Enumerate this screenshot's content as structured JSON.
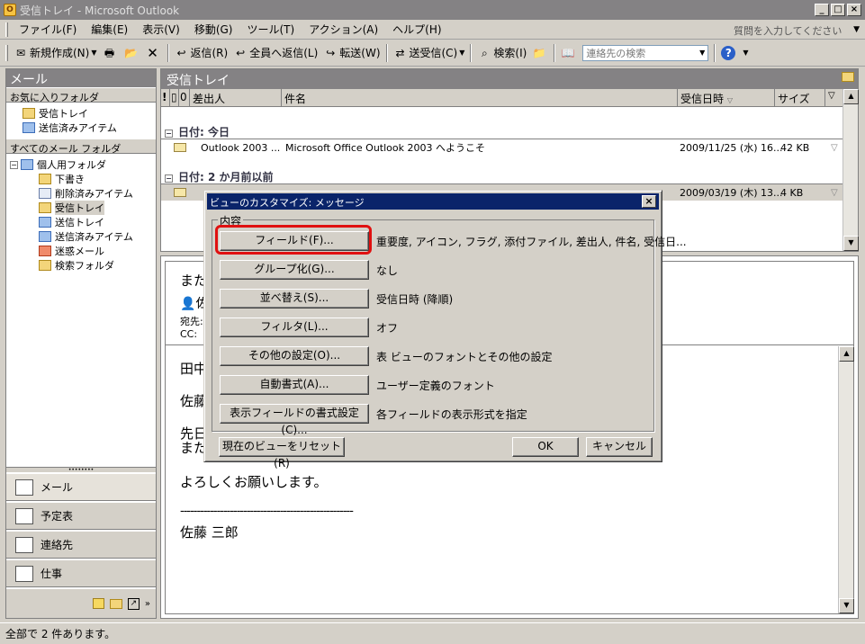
{
  "window": {
    "title": "受信トレイ - Microsoft Outlook",
    "app_icon": "outlook-icon"
  },
  "menubar": {
    "items": [
      "ファイル(F)",
      "編集(E)",
      "表示(V)",
      "移動(G)",
      "ツール(T)",
      "アクション(A)",
      "ヘルプ(H)"
    ],
    "help_placeholder": "質問を入力してください"
  },
  "toolbar": {
    "new": "新規作成(N)",
    "reply": "返信(R)",
    "reply_all": "全員へ返信(L)",
    "forward": "転送(W)",
    "send_receive": "送受信(C)",
    "find": "検索(I)",
    "contact_search_placeholder": "連絡先の検索"
  },
  "nav": {
    "header": "メール",
    "favorites_header": "お気に入りフォルダ",
    "favorites": [
      "受信トレイ",
      "送信済みアイテム"
    ],
    "all_header": "すべてのメール フォルダ",
    "root": "個人用フォルダ",
    "folders": [
      "下書き",
      "削除済みアイテム",
      "受信トレイ",
      "送信トレイ",
      "送信済みアイテム",
      "迷惑メール",
      "検索フォルダ"
    ],
    "buttons": [
      "メール",
      "予定表",
      "連絡先",
      "仕事"
    ]
  },
  "list": {
    "header": "受信トレイ",
    "columns": [
      "差出人",
      "件名",
      "受信日時",
      "サイズ"
    ],
    "groups": [
      {
        "label": "日付: 今日",
        "rows": [
          {
            "from": "Outlook 2003 ...",
            "subject": "Microsoft Office Outlook 2003 へようこそ",
            "received": "2009/11/25 (水) 16...",
            "size": "42 KB"
          }
        ]
      },
      {
        "label": "日付: 2 か月前以前",
        "rows": [
          {
            "from": "",
            "subject": "",
            "received": "2009/03/19 (木) 13...",
            "size": "4 KB"
          }
        ]
      }
    ]
  },
  "reading": {
    "subject_fragment": "また",
    "to_label": "宛先:",
    "cc_label": "CC:",
    "sender_fragment": "佐",
    "body_lines": [
      "田中",
      "佐藤",
      "先日",
      "また"
    ],
    "closing": "よろしくお願いします。",
    "separator": "----------------------------------------------------",
    "signature": "佐藤 三郎"
  },
  "dialog": {
    "title": "ビューのカスタマイズ: メッセージ",
    "group_label": "内容",
    "rows": [
      {
        "button": "フィールド(F)...",
        "value": "重要度, アイコン, フラグ, 添付ファイル, 差出人, 件名, 受信日..."
      },
      {
        "button": "グループ化(G)...",
        "value": "なし"
      },
      {
        "button": "並べ替え(S)...",
        "value": "受信日時 (降順)"
      },
      {
        "button": "フィルタ(L)...",
        "value": "オフ"
      },
      {
        "button": "その他の設定(O)...",
        "value": "表 ビューのフォントとその他の設定"
      },
      {
        "button": "自動書式(A)...",
        "value": "ユーザー定義のフォント"
      },
      {
        "button": "表示フィールドの書式設定(C)...",
        "value": "各フィールドの表示形式を指定"
      }
    ],
    "reset": "現在のビューをリセット(R)",
    "ok": "OK",
    "cancel": "キャンセル"
  },
  "status": "全部で 2 件あります。"
}
